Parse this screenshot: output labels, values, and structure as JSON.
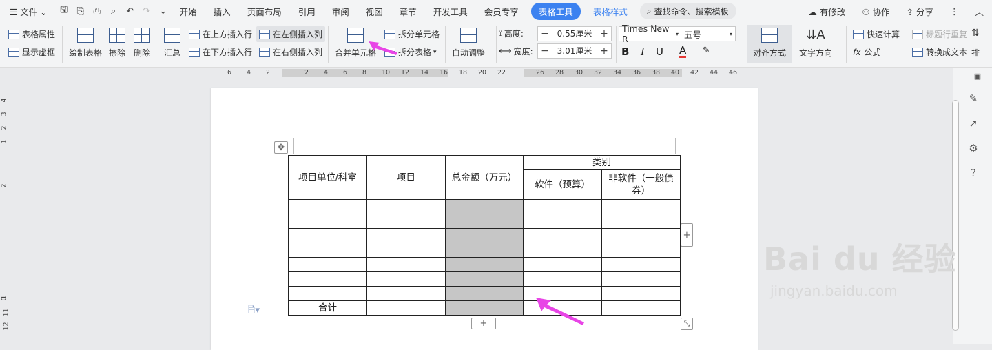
{
  "menubar": {
    "file": "文件",
    "tabs": [
      "开始",
      "插入",
      "页面布局",
      "引用",
      "审阅",
      "视图",
      "章节",
      "开发工具",
      "会员专享"
    ],
    "active_tab": "表格工具",
    "style_tab": "表格样式",
    "search_placeholder": "查找命令、搜索模板",
    "has_changes": "有修改",
    "collab": "协作",
    "share": "分享"
  },
  "ribbon": {
    "table_props": "表格属性",
    "show_gridlines": "显示虚框",
    "draw_table": "绘制表格",
    "erase": "擦除",
    "delete": "删除",
    "summary": "汇总",
    "insert_above": "在上方插入行",
    "insert_below": "在下方插入行",
    "insert_left": "在左侧插入列",
    "insert_right": "在右侧插入列",
    "merge_cells": "合并单元格",
    "split_cells": "拆分单元格",
    "split_table": "拆分表格",
    "auto_fit": "自动调整",
    "height_label": "高度:",
    "height_value": "0.55厘米",
    "width_label": "宽度:",
    "width_value": "3.01厘米",
    "font_name": "Times New R",
    "font_size": "五号",
    "align": "对齐方式",
    "text_dir": "文字方向",
    "quick_calc": "快速计算",
    "repeat_header": "标题行重复",
    "to_text": "转换成文本",
    "formula": "公式",
    "sort": "排"
  },
  "ruler_labels": [
    "6",
    "4",
    "2",
    "2",
    "4",
    "6",
    "8",
    "10",
    "12",
    "14",
    "16",
    "18",
    "20",
    "22",
    "26",
    "28",
    "30",
    "32",
    "34",
    "36",
    "38",
    "40",
    "42",
    "44",
    "46"
  ],
  "vruler_labels": [
    "4",
    "3",
    "2",
    "1",
    "2",
    "1",
    "0",
    "11",
    "12"
  ],
  "table": {
    "headers": [
      "项目单位/科室",
      "项目",
      "总金额（万元）",
      "类别"
    ],
    "subheaders": [
      "软件（预算）",
      "非软件（一般债券）"
    ],
    "empty_rows": 7,
    "total_label": "合计"
  },
  "watermark": {
    "logo": "Bai du 经验",
    "url": "jingyan.baidu.com"
  },
  "colors": {
    "accent": "#3c82f0",
    "arrow": "#e845e6",
    "shade": "#c6c6c6"
  }
}
